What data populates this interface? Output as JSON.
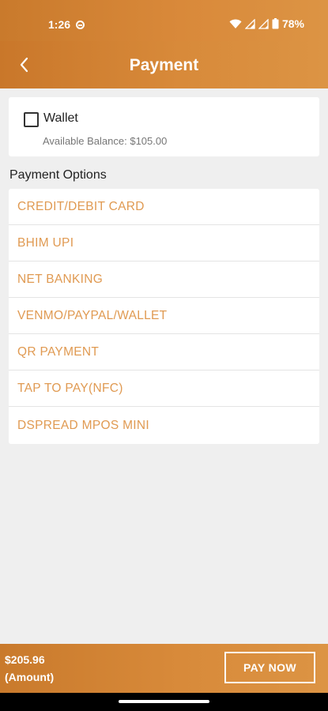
{
  "status_bar": {
    "time": "1:26",
    "battery": "78%",
    "icons": [
      "data-saver-icon",
      "wifi-icon",
      "signal-icon",
      "signal-icon",
      "battery-icon"
    ]
  },
  "header": {
    "title": "Payment",
    "back_icon": "chevron-left-icon"
  },
  "wallet": {
    "label": "Wallet",
    "checked": false,
    "balance": "Available Balance: $105.00"
  },
  "payment_options": {
    "heading": "Payment Options",
    "items": [
      {
        "label": "CREDIT/DEBIT CARD"
      },
      {
        "label": "BHIM UPI"
      },
      {
        "label": "NET BANKING"
      },
      {
        "label": "VENMO/PAYPAL/WALLET"
      },
      {
        "label": "QR PAYMENT"
      },
      {
        "label": "TAP TO PAY(NFC)"
      },
      {
        "label": "DSPREAD MPOS MINI"
      }
    ]
  },
  "footer": {
    "amount": "$205.96",
    "amount_caption": "(Amount)",
    "pay_button": "PAY NOW"
  },
  "colors": {
    "accent": "#d9883a",
    "option_text": "#e09a52",
    "background": "#efefef"
  }
}
